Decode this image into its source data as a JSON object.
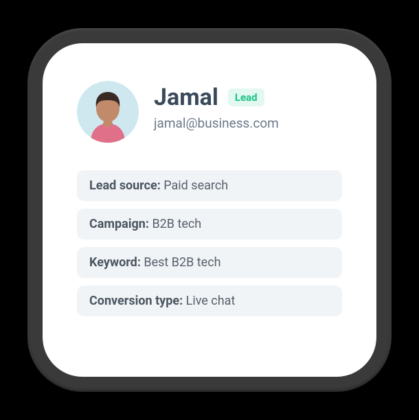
{
  "contact": {
    "name": "Jamal",
    "badge": "Lead",
    "email": "jamal@business.com"
  },
  "details": {
    "lead_source": {
      "label": "Lead source:",
      "value": "Paid search"
    },
    "campaign": {
      "label": "Campaign:",
      "value": "B2B tech"
    },
    "keyword": {
      "label": "Keyword:",
      "value": "Best B2B tech"
    },
    "conversion": {
      "label": "Conversion type:",
      "value": "Live chat"
    }
  }
}
